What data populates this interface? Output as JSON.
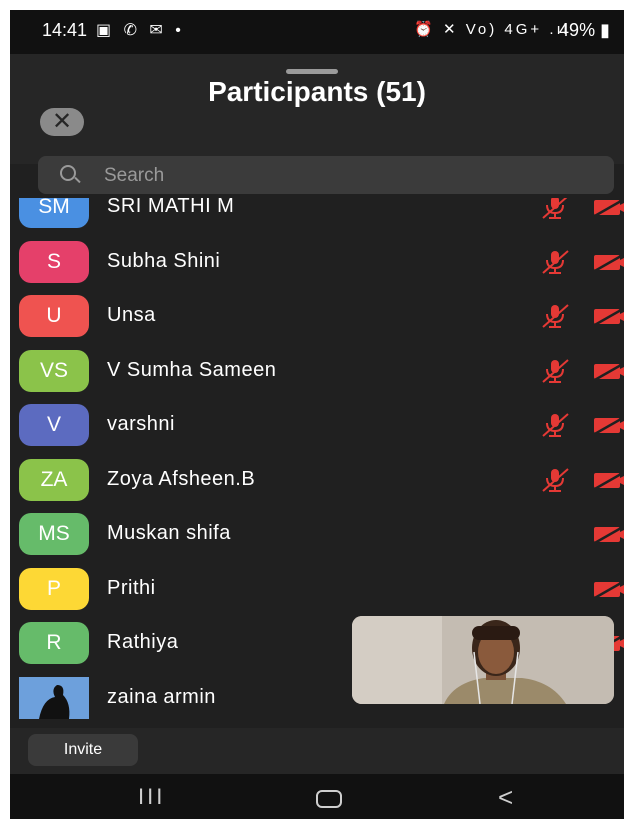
{
  "status_bar": {
    "time": "14:41",
    "left_icons": "▣ ✆ ✉ •",
    "right_icons": "⏰ ✕ Vo) 4G+ .ıl",
    "battery": "49%"
  },
  "header": {
    "title": "Participants (51)",
    "close_icon": "✕"
  },
  "search": {
    "placeholder": "Search"
  },
  "participants": [
    {
      "initials": "SM",
      "name": "SRI MATHI M",
      "color": "#4a90e2",
      "mic_muted": true,
      "video_off": true
    },
    {
      "initials": "S",
      "name": "Subha Shini",
      "color": "#e5406a",
      "mic_muted": true,
      "video_off": true
    },
    {
      "initials": "U",
      "name": "Unsa",
      "color": "#ef5350",
      "mic_muted": true,
      "video_off": true
    },
    {
      "initials": "VS",
      "name": "V Sumha Sameen",
      "color": "#8bc34a",
      "mic_muted": true,
      "video_off": true
    },
    {
      "initials": "V",
      "name": "varshni",
      "color": "#5c6bc0",
      "mic_muted": true,
      "video_off": true
    },
    {
      "initials": "ZA",
      "name": "Zoya Afsheen.B",
      "color": "#8bc34a",
      "mic_muted": true,
      "video_off": true
    },
    {
      "initials": "MS",
      "name": "Muskan shifa",
      "color": "#66bb6a",
      "mic_muted": false,
      "video_off": true
    },
    {
      "initials": "P",
      "name": "Prithi",
      "color": "#fdd835",
      "mic_muted": false,
      "video_off": true
    },
    {
      "initials": "R",
      "name": "Rathiya",
      "color": "#66bb6a",
      "mic_muted": false,
      "video_off": true
    },
    {
      "initials": "",
      "name": "zaina armin",
      "color": "#1e88e5",
      "mic_muted": false,
      "video_off": false
    }
  ],
  "footer": {
    "invite_label": "Invite"
  },
  "nav": {
    "recent": "III",
    "back": "<"
  }
}
